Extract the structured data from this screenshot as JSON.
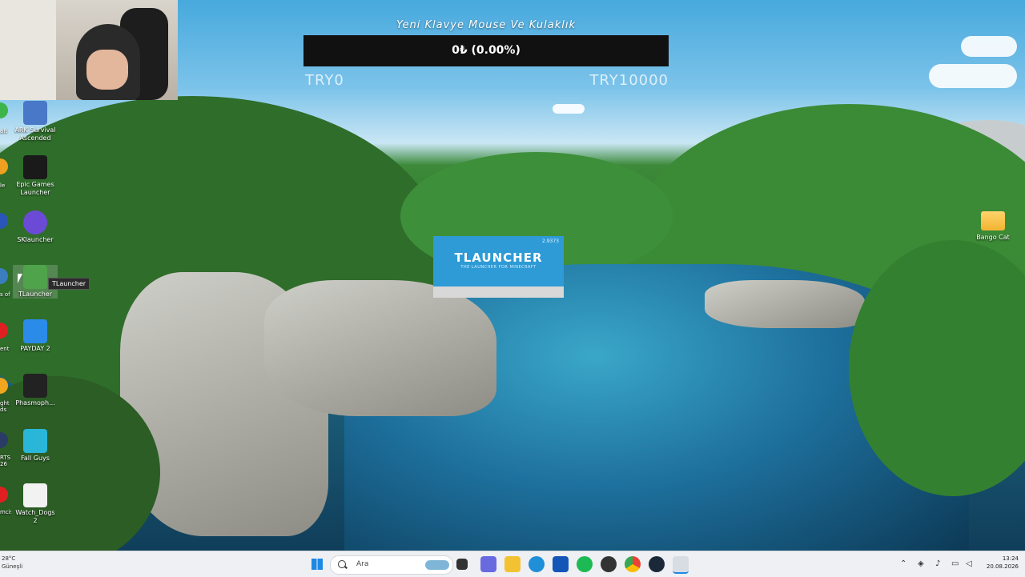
{
  "overlay": {
    "goal_title": "Yeni Klavye Mouse Ve Kulaklık",
    "goal_value": "0₺ (0.00%)",
    "goal_progress": 0.0,
    "goal_min": "TRY0",
    "goal_max": "TRY10000"
  },
  "desktop_icons": [
    {
      "label": "ARK Survival Ascended",
      "line1": "ARK Survival",
      "line2": "Ascended",
      "color": "#4a78c8",
      "icon": "ark-icon"
    },
    {
      "label": "Epic Games Launcher",
      "line1": "Epic Games",
      "line2": "Launcher",
      "color": "#1a1a1a",
      "icon": "epic-icon"
    },
    {
      "label": "SKlauncher",
      "line1": "SKlauncher",
      "line2": "",
      "color": "#6b4bd6",
      "icon": "sklauncher-icon"
    },
    {
      "label": "TLauncher",
      "line1": "TLauncher",
      "line2": "",
      "color": "#4fa34a",
      "icon": "tlauncher-icon"
    },
    {
      "label": "PAYDAY 2",
      "line1": "PAYDAY 2",
      "line2": "",
      "color": "#2a8be8",
      "icon": "payday-icon"
    },
    {
      "label": "Phasmophobia",
      "line1": "Phasmoph...",
      "line2": "",
      "color": "#222222",
      "icon": "phasmophobia-icon"
    },
    {
      "label": "Fall Guys",
      "line1": "Fall Guys",
      "line2": "",
      "color": "#29b6d8",
      "icon": "fall-guys-icon"
    },
    {
      "label": "Watch_Dogs 2",
      "line1": "Watch_Dogs",
      "line2": "2",
      "color": "#f2f2f2",
      "icon": "watch-dogs-icon"
    }
  ],
  "edge_labels": [
    "oft",
    "le",
    "",
    "s of",
    "ent",
    "ght\nds",
    "RTS\n26",
    "mcisi"
  ],
  "tooltip": "TLauncher",
  "bango_cat": "Bango Cat",
  "splash": {
    "title": "TLAUNCHER",
    "subtitle": "THE LAUNCHER FOR MINECRAFT",
    "version": "2.9373"
  },
  "taskbar": {
    "weather_temp": "28°C",
    "weather_text": "Güneşli",
    "search_placeholder": "Ara",
    "time": "13:24",
    "date": "20.08.2026"
  }
}
